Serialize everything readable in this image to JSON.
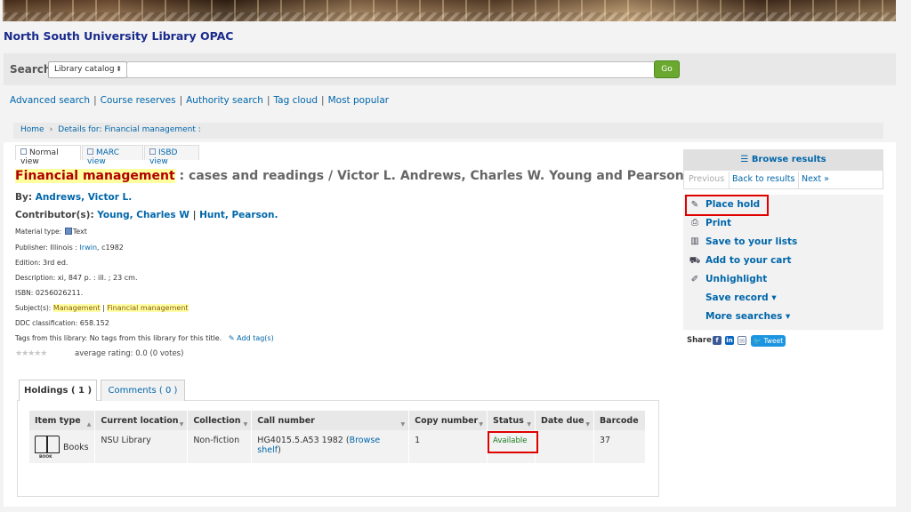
{
  "site": {
    "title": "North South University Library OPAC"
  },
  "search": {
    "label": "Search",
    "scope": "Library catalog",
    "query": "",
    "go_label": "Go"
  },
  "quicklinks": [
    "Advanced search",
    "Course reserves",
    "Authority search",
    "Tag cloud",
    "Most popular"
  ],
  "breadcrumb": {
    "home": "Home",
    "current": "Details for: Financial management :"
  },
  "views": {
    "normal": "Normal view",
    "marc": "MARC view",
    "isbd": "ISBD view"
  },
  "record": {
    "title_main": "Financial management",
    "title_rest": " : cases and readings / Victor L. Andrews, Charles W. Young and Pearson Hunt",
    "by_label": "By:",
    "by": "Andrews, Victor L.",
    "contrib_label": "Contributor(s):",
    "contrib_1": "Young, Charles W",
    "contrib_2": "Hunt, Pearson.",
    "material_label": "Material type:",
    "material": "Text",
    "publisher_label": "Publisher:",
    "publisher_place": "Illinois : ",
    "publisher_name": "Irwin",
    "publisher_year": ", c1982",
    "edition_label": "Edition:",
    "edition": "3rd ed.",
    "description_label": "Description:",
    "description": "xi, 847 p. : ill. ; 23 cm.",
    "isbn_label": "ISBN:",
    "isbn": "0256026211.",
    "subjects_label": "Subject(s):",
    "subject_1": "Management",
    "subject_2": "Financial management",
    "ddc_label": "DDC classification:",
    "ddc": "658.152",
    "tags_label": "Tags from this library:",
    "tags": "No tags from this library for this title.",
    "add_tag": "Add tag(s)",
    "stars": "★★★★★",
    "rating": "average rating: 0.0 (0 votes)"
  },
  "holdings_tabs": {
    "holdings": "Holdings ( 1 )",
    "comments": "Comments ( 0 )"
  },
  "holdings": {
    "headers": [
      "Item type",
      "Current location",
      "Collection",
      "Call number",
      "Copy number",
      "Status",
      "Date due",
      "Barcode"
    ],
    "row": {
      "item_type": "Books",
      "item_icon_text": "BOOK",
      "location": "NSU Library",
      "collection": "Non-fiction",
      "call_number": "HG4015.5.A53 1982",
      "browse_shelf": "Browse shelf",
      "copy_number": "1",
      "status": "Available",
      "date_due": "",
      "barcode": "37"
    }
  },
  "sidebar": {
    "browse_results": "Browse results",
    "previous": "Previous",
    "back": "Back to results",
    "next": "Next »",
    "actions": {
      "place_hold": "Place hold",
      "print": "Print",
      "save_lists": "Save to your lists",
      "add_cart": "Add to your cart",
      "unhighlight": "Unhighlight",
      "save_record": "Save record ▾",
      "more_searches": "More searches ▾"
    },
    "share_label": "Share",
    "tweet": "Tweet"
  },
  "colors": {
    "link": "#0066aa",
    "highlight": "#ffffa0",
    "annotation": "#e00000",
    "go_button": "#6aa82f"
  }
}
